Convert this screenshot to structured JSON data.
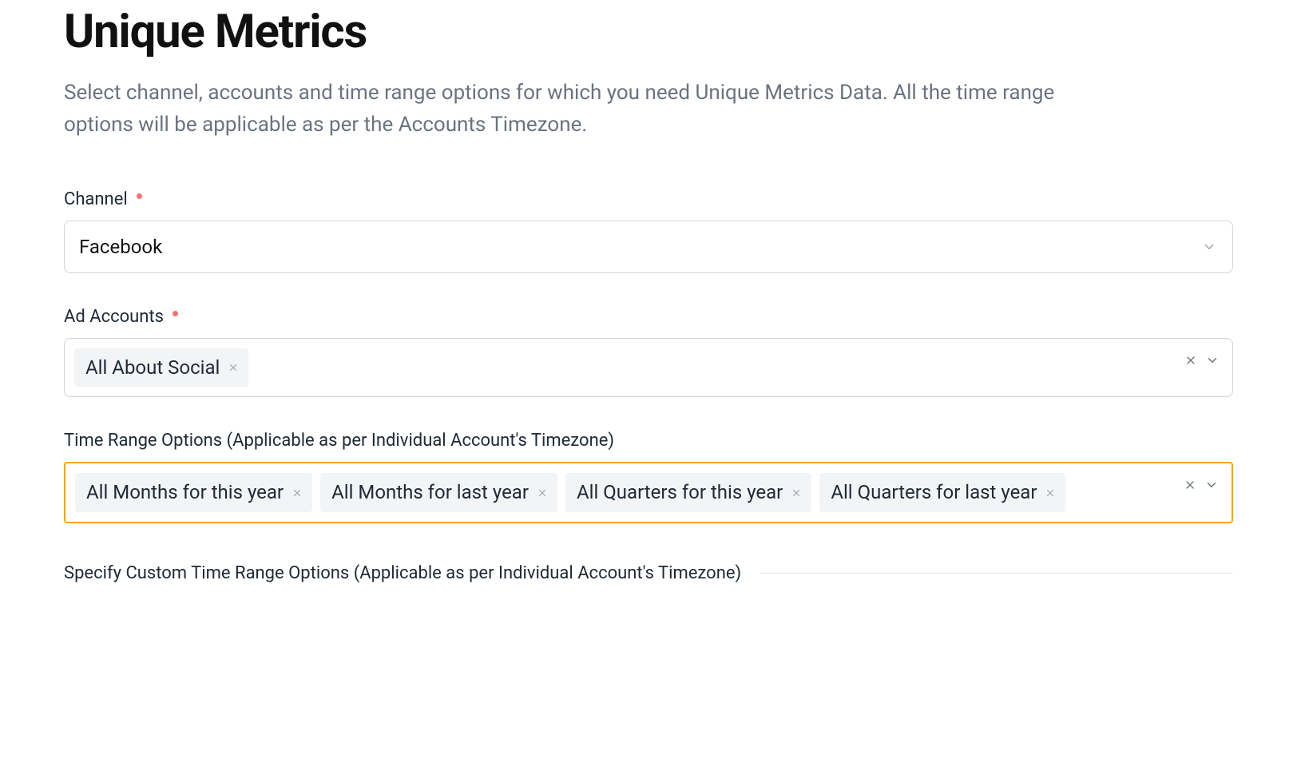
{
  "header": {
    "title": "Unique Metrics",
    "description": "Select channel, accounts and time range options for which you need Unique Metrics Data. All the time range options will be applicable as per the Accounts Timezone."
  },
  "channel": {
    "label": "Channel",
    "value": "Facebook"
  },
  "adAccounts": {
    "label": "Ad Accounts",
    "tags": [
      {
        "label": "All About Social"
      }
    ]
  },
  "timeRange": {
    "label": "Time Range Options (Applicable as per Individual Account's Timezone)",
    "tags": [
      {
        "label": "All Months for this year"
      },
      {
        "label": "All Months for last year"
      },
      {
        "label": "All Quarters for this year"
      },
      {
        "label": "All Quarters for last year"
      }
    ]
  },
  "customRange": {
    "label": "Specify Custom Time Range Options (Applicable as per Individual Account's Timezone)"
  }
}
